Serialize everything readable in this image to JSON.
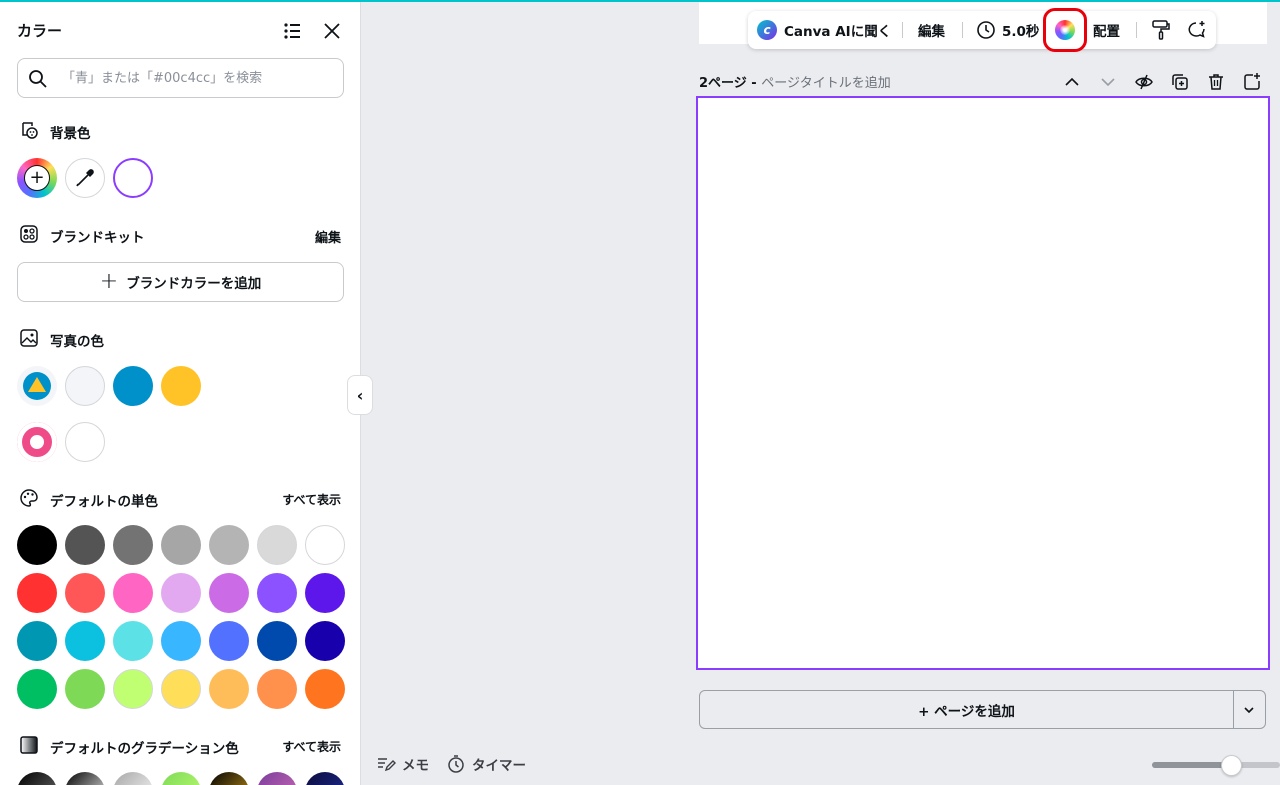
{
  "panel": {
    "title": "カラー",
    "search_placeholder": "「青」または「#00c4cc」を検索",
    "background": {
      "title": "背景色",
      "current_color": "#ffffff"
    },
    "brand_kit": {
      "title": "ブランドキット",
      "edit_label": "編集",
      "add_label": "ブランドカラーを追加"
    },
    "photo": {
      "title": "写真の色",
      "colors": [
        "#f4f5f8",
        "#0091ca",
        "#ffc328",
        "#f04b89",
        "#ffffff"
      ]
    },
    "default_solid": {
      "title": "デフォルトの単色",
      "show_all": "すべて表示",
      "colors": [
        "#000000",
        "#545454",
        "#737373",
        "#a6a6a6",
        "#b4b4b4",
        "#d9d9d9",
        "#ffffff",
        "#ff3131",
        "#ff5757",
        "#ff66c4",
        "#e2a9f1",
        "#cb6ce6",
        "#8c52ff",
        "#5e17eb",
        "#0097b2",
        "#0cc0df",
        "#5ce1e6",
        "#38b6ff",
        "#5271ff",
        "#004aad",
        "#1800ad",
        "#00bf63",
        "#7ed957",
        "#c1ff72",
        "#ffde59",
        "#ffbd59",
        "#ff914d",
        "#ff751f"
      ]
    },
    "default_gradient": {
      "title": "デフォルトのグラデーション色",
      "show_all": "すべて表示"
    }
  },
  "toolbar": {
    "ai_label": "Canva AIに聞く",
    "edit_label": "編集",
    "duration": "5.0秒",
    "arrange_label": "配置"
  },
  "page": {
    "number_label": "2ページ - ",
    "title_placeholder": "ページタイトルを追加"
  },
  "add_page_label": "+ ページを追加",
  "footer": {
    "notes_label": "メモ",
    "timer_label": "タイマー"
  },
  "zoom": {
    "level_fraction": 0.62
  }
}
